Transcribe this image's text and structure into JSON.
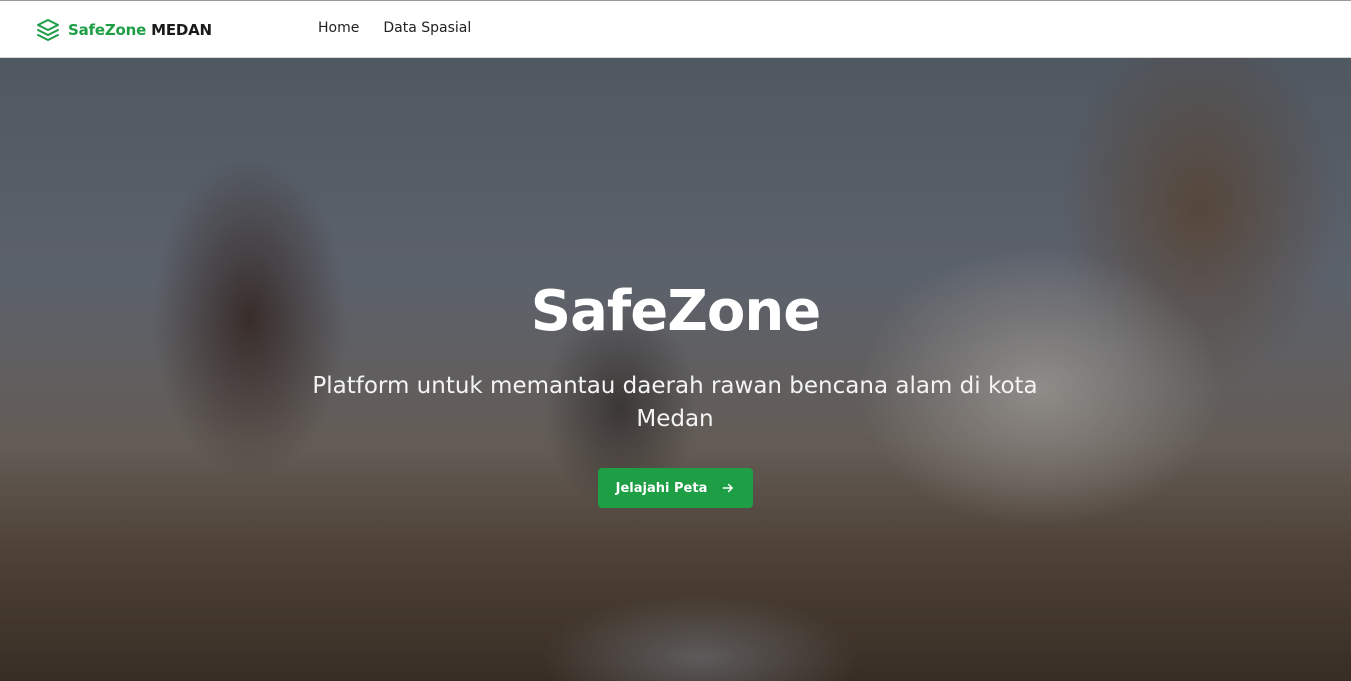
{
  "navbar": {
    "brand_primary": "SafeZone",
    "brand_secondary": "MEDAN",
    "brand_icon": "layers-icon",
    "links": [
      {
        "label": "Home"
      },
      {
        "label": "Data Spasial"
      }
    ]
  },
  "hero": {
    "title": "SafeZone",
    "subtitle": "Platform untuk memantau daerah rawan bencana alam di kota Medan",
    "cta_label": "Jelajahi Peta",
    "cta_icon": "arrow-right-icon",
    "background_image": "volunteer picking up plastic bottle on sandy beach"
  },
  "colors": {
    "accent": "#1e9e45",
    "text_dark": "#1a1a1a",
    "hero_text": "#ffffff"
  }
}
